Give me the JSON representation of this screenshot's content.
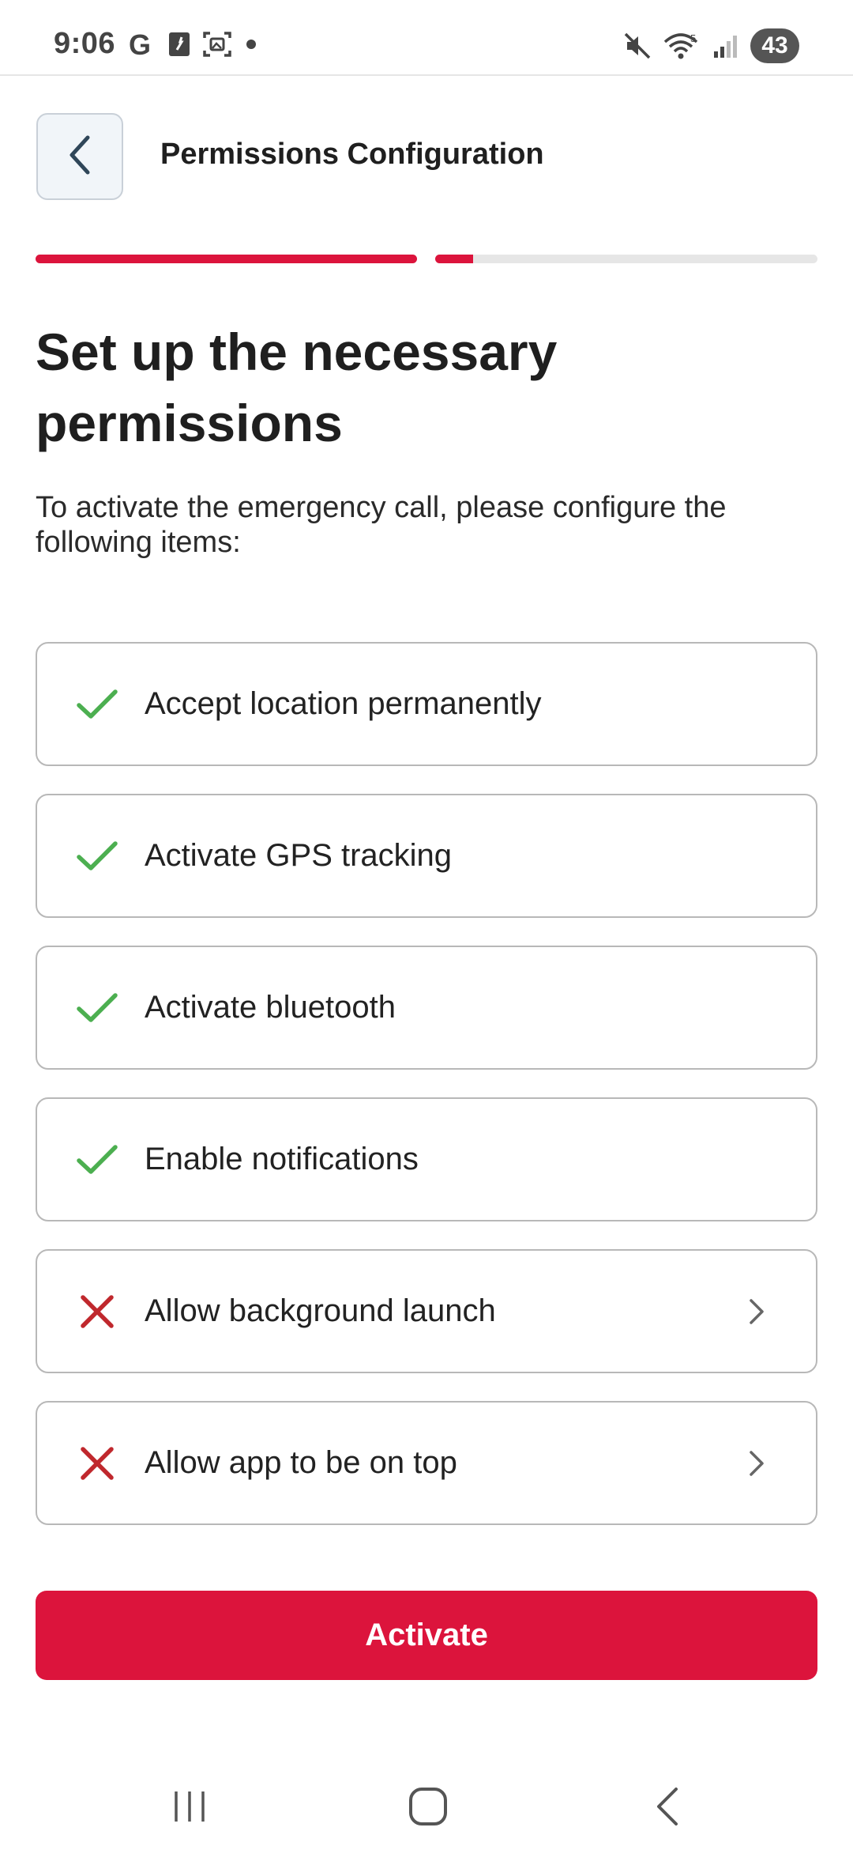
{
  "status_bar": {
    "time": "9:06",
    "battery": "43",
    "icons_left": [
      "google-icon",
      "sim-icon",
      "screenshot-icon",
      "dot-icon"
    ],
    "icons_right": [
      "mute-icon",
      "wifi-icon",
      "signal-icon"
    ]
  },
  "header": {
    "title": "Permissions Configuration",
    "back_icon": "chevron-left-icon"
  },
  "progress": {
    "segments": [
      {
        "fill_fraction": 1.0
      },
      {
        "fill_fraction": 0.1
      }
    ],
    "accent_color": "#dc143c"
  },
  "main": {
    "heading": "Set up the necessary permissions",
    "subtitle": "To activate the emergency call, please configure the following items:"
  },
  "items": [
    {
      "label": "Accept location permanently",
      "status": "done"
    },
    {
      "label": "Activate GPS tracking",
      "status": "done"
    },
    {
      "label": "Activate bluetooth",
      "status": "done"
    },
    {
      "label": "Enable notifications",
      "status": "done"
    },
    {
      "label": "Allow background launch",
      "status": "pending"
    },
    {
      "label": "Allow app to be on top",
      "status": "pending"
    }
  ],
  "colors": {
    "check": "#4caf50",
    "cross": "#c0282d",
    "accent": "#dc143c"
  },
  "activate_button": {
    "label": "Activate"
  },
  "navbar": {
    "icons": [
      "recent-apps-icon",
      "home-icon",
      "back-icon"
    ]
  }
}
